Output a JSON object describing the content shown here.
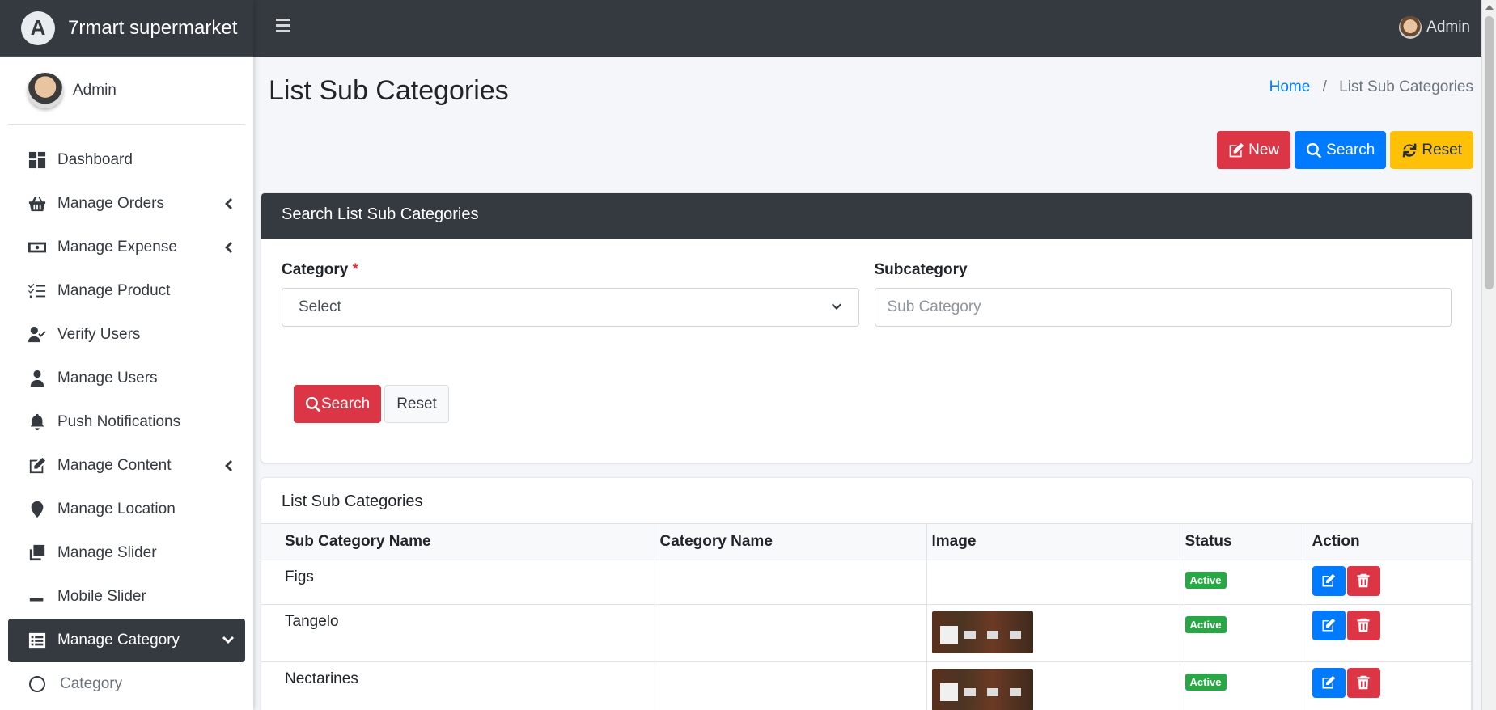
{
  "brand": {
    "name": "7rmart supermarket",
    "logo_letter": "A"
  },
  "user": {
    "name": "Admin"
  },
  "topbar": {
    "user_name": "Admin"
  },
  "sidebar": {
    "items": [
      {
        "label": "Dashboard",
        "icon": "dashboard-icon"
      },
      {
        "label": "Manage Orders",
        "icon": "basket-icon",
        "expandable": true
      },
      {
        "label": "Manage Expense",
        "icon": "money-icon",
        "expandable": true
      },
      {
        "label": "Manage Product",
        "icon": "tasks-icon"
      },
      {
        "label": "Verify Users",
        "icon": "user-check-icon"
      },
      {
        "label": "Manage Users",
        "icon": "user-icon"
      },
      {
        "label": "Push Notifications",
        "icon": "bell-icon"
      },
      {
        "label": "Manage Content",
        "icon": "edit-icon",
        "expandable": true
      },
      {
        "label": "Manage Location",
        "icon": "map-marker-icon"
      },
      {
        "label": "Manage Slider",
        "icon": "clone-icon"
      },
      {
        "label": "Mobile Slider",
        "icon": "minus-icon"
      },
      {
        "label": "Manage Category",
        "icon": "list-alt-icon",
        "active": true
      },
      {
        "label": "Category",
        "icon": "circle-icon"
      }
    ]
  },
  "page": {
    "title": "List Sub Categories"
  },
  "breadcrumb": {
    "home": "Home",
    "current": "List Sub Categories"
  },
  "actions": {
    "new": "New",
    "search": "Search",
    "reset": "Reset"
  },
  "search_card": {
    "title": "Search List Sub Categories",
    "category_label": "Category",
    "required_mark": "*",
    "category_value": "Select",
    "subcategory_label": "Subcategory",
    "subcategory_placeholder": "Sub Category",
    "search_button": "Search",
    "reset_button": "Reset"
  },
  "list_card": {
    "title": "List Sub Categories",
    "columns": [
      "Sub Category Name",
      "Category Name",
      "Image",
      "Status",
      "Action"
    ],
    "rows": [
      {
        "name": "Figs",
        "category": "",
        "has_image": false,
        "status": "Active"
      },
      {
        "name": "Tangelo",
        "category": "",
        "has_image": true,
        "status": "Active"
      },
      {
        "name": "Nectarines",
        "category": "",
        "has_image": true,
        "status": "Active"
      }
    ]
  },
  "colors": {
    "dark": "#343a40",
    "danger": "#dc3545",
    "primary": "#007bff",
    "warning": "#ffc107",
    "success": "#28a745"
  }
}
